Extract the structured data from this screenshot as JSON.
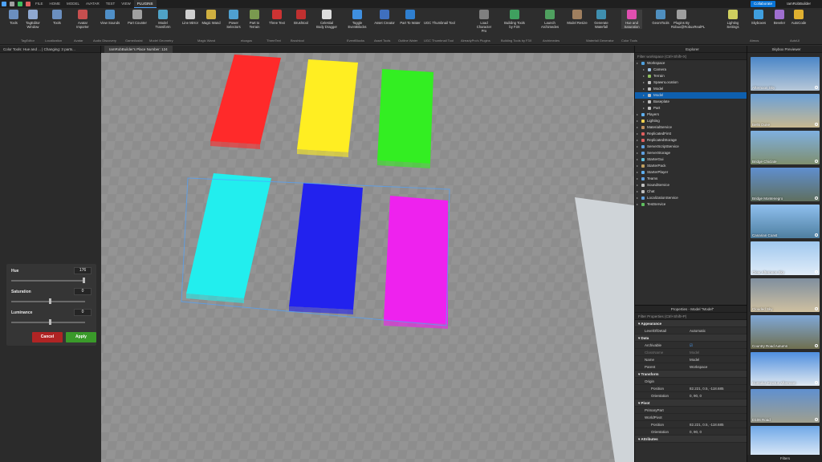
{
  "menubar": {
    "items": [
      "FILE",
      "HOME",
      "MODEL",
      "AVATAR",
      "TEST",
      "VIEW",
      "PLUGINS"
    ],
    "active": "PLUGINS",
    "collaborate": "Collaborate",
    "user": "IamRobBuilder"
  },
  "ribbon": {
    "buttons": [
      {
        "label": "Tools",
        "color": "#6b8fbf"
      },
      {
        "label": "TagEditor Window",
        "color": "#8fa8d0"
      },
      {
        "label": "Tools",
        "color": "#6b8fbf"
      },
      {
        "label": "Avatar Importer",
        "color": "#c74f4f"
      },
      {
        "label": "View Sounds",
        "color": "#4f8fc7"
      },
      {
        "label": "Part Counter",
        "color": "#a0a0a0"
      },
      {
        "label": "Model Transform",
        "color": "#4fa3c7"
      },
      {
        "label": "Line Mirror",
        "color": "#cfcfcf"
      },
      {
        "label": "Magic Wand",
        "color": "#d0b040"
      },
      {
        "label": "Power Selectors",
        "color": "#4fa0d0"
      },
      {
        "label": "Part to Terrain",
        "color": "#7a9a4f"
      },
      {
        "label": "Three Text",
        "color": "#cc3333"
      },
      {
        "label": "Brushtool",
        "color": "#c03030"
      },
      {
        "label": "Celestial Body Dragger",
        "color": "#dddddd"
      },
      {
        "label": "Toggle EventBlocks",
        "color": "#3f8fdf"
      },
      {
        "label": "Asset Creator",
        "color": "#3f6fbf"
      },
      {
        "label": "Part To Water",
        "color": "#2f7fcf"
      },
      {
        "label": "Load Character Pro",
        "color": "#7f7f7f"
      },
      {
        "label": "Building Tools by F3X",
        "color": "#3fa05f"
      },
      {
        "label": "Launch Archimedes",
        "color": "#4fa05f"
      },
      {
        "label": "Model Resize",
        "color": "#9f7f5f"
      },
      {
        "label": "Generate Waterfall",
        "color": "#3f8faf"
      },
      {
        "label": "Hue and Saturation",
        "color": "#e04fb0"
      },
      {
        "label": "GeomTools",
        "color": "#4f8fbf"
      },
      {
        "label": "Plugins By Robux@RobuxRealPL",
        "color": "#9f9f9f"
      },
      {
        "label": "Lighting Settings",
        "color": "#cfcf5f"
      },
      {
        "label": "Skyboxes",
        "color": "#3f9fdf"
      },
      {
        "label": "Beveler",
        "color": "#9f6fcf"
      },
      {
        "label": "AutoCode",
        "color": "#e0b030"
      }
    ],
    "groups": [
      "TagEditor",
      "Localization",
      "Avatar",
      "Audio Discovery",
      "GameAssist",
      "Model Geometry",
      "Magic Wand",
      "eloagus",
      "ThreeText",
      "Brushtool",
      "EventBlocks",
      "Asset Tools",
      "Outline Water",
      "UGC Thumbnail Tool",
      "AlreadyPro's Plugins",
      "Building Tools by F3X",
      "Archimedes",
      "Waterfall Generator",
      "Color Tools",
      "Atmos",
      "AutoUI"
    ],
    "extra": "UGC Thumbnail Tool"
  },
  "colorTools": {
    "title": "Color Tools: Hue and ... | Changing: 3 parts...",
    "hue": {
      "label": "Hue",
      "value": "176",
      "fraction": 0.98
    },
    "saturation": {
      "label": "Saturation",
      "value": "0",
      "fraction": 0.52
    },
    "luminance": {
      "label": "Luminance",
      "value": "0",
      "fraction": 0.52
    },
    "cancel": "Cancel",
    "apply": "Apply",
    "colors": {
      "cancel": "#b02424",
      "apply": "#3a9a2a"
    }
  },
  "viewport": {
    "tab": "IamRobBuilder's Place Number: 124",
    "parts": [
      "#ff2a2a",
      "#ffee22",
      "#33ee22",
      "#22eeee",
      "#2222ee",
      "#ee22ee"
    ]
  },
  "explorer": {
    "title": "Explorer",
    "filter": "Filter workspace (Ctrl+Shift+X)",
    "items": [
      {
        "label": "Workspace",
        "depth": 0,
        "color": "#4fa0df"
      },
      {
        "label": "Camera",
        "depth": 1,
        "color": "#9fbfdf"
      },
      {
        "label": "Terrain",
        "depth": 1,
        "color": "#8fbf5f"
      },
      {
        "label": "SpawnLocation",
        "depth": 1,
        "color": "#bfbfbf"
      },
      {
        "label": "Model",
        "depth": 1,
        "color": "#bfbfbf"
      },
      {
        "label": "Model",
        "depth": 1,
        "color": "#bfbfbf",
        "selected": true
      },
      {
        "label": "Baseplate",
        "depth": 1,
        "color": "#bfbfbf"
      },
      {
        "label": "Part",
        "depth": 1,
        "color": "#bfbfbf"
      },
      {
        "label": "Players",
        "depth": 0,
        "color": "#5fafef"
      },
      {
        "label": "Lighting",
        "depth": 0,
        "color": "#efcf4f"
      },
      {
        "label": "MaterialService",
        "depth": 0,
        "color": "#bf8f5f"
      },
      {
        "label": "ReplicatedFirst",
        "depth": 0,
        "color": "#df5f5f"
      },
      {
        "label": "ReplicatedStorage",
        "depth": 0,
        "color": "#df5f5f"
      },
      {
        "label": "ServerScriptService",
        "depth": 0,
        "color": "#5f9fdf"
      },
      {
        "label": "ServerStorage",
        "depth": 0,
        "color": "#5f9fdf"
      },
      {
        "label": "StarterGui",
        "depth": 0,
        "color": "#5fbfdf"
      },
      {
        "label": "StarterPack",
        "depth": 0,
        "color": "#bf9f5f"
      },
      {
        "label": "StarterPlayer",
        "depth": 0,
        "color": "#5fafef"
      },
      {
        "label": "Teams",
        "depth": 0,
        "color": "#5f9fdf"
      },
      {
        "label": "SoundService",
        "depth": 0,
        "color": "#bfbfbf"
      },
      {
        "label": "Chat",
        "depth": 0,
        "color": "#bfbfbf"
      },
      {
        "label": "LocalizationService",
        "depth": 0,
        "color": "#5f9fdf"
      },
      {
        "label": "TestService",
        "depth": 0,
        "color": "#5fbf5f"
      }
    ]
  },
  "properties": {
    "title": "Properties - Model \"Model\"",
    "filter": "Filter Properties (Ctrl+Shift+P)",
    "rows": [
      {
        "cat": "Appearance"
      },
      {
        "k": "LevelOfDetail",
        "v": "Automatic"
      },
      {
        "cat": "Data"
      },
      {
        "k": "Archivable",
        "v": "☑"
      },
      {
        "k": "ClassName",
        "v": "Model",
        "dim": true
      },
      {
        "k": "Name",
        "v": "Model"
      },
      {
        "k": "Parent",
        "v": "Workspace"
      },
      {
        "cat": "Transform"
      },
      {
        "k": "Origin",
        "v": ""
      },
      {
        "k": "Position",
        "v": "82.221, 0.5, -118.685",
        "indent": true
      },
      {
        "k": "Orientation",
        "v": "0, 90, 0",
        "indent": true
      },
      {
        "cat": "Pivot"
      },
      {
        "k": "PrimaryPart",
        "v": ""
      },
      {
        "k": "WorldPivot",
        "v": ""
      },
      {
        "k": "Position",
        "v": "82.221, 0.5, -118.685",
        "indent": true
      },
      {
        "k": "Orientation",
        "v": "0, 90, 0",
        "indent": true
      },
      {
        "cat": "Attributes"
      }
    ]
  },
  "skybox": {
    "title": "Skybox Previewer",
    "items": [
      {
        "name": "Afternoon Sky",
        "top": "#4a86c8",
        "bottom": "#b8c8d8"
      },
      {
        "name": "Belts Dune",
        "top": "#6aa0d8",
        "bottom": "#c8b890"
      },
      {
        "name": "Bridge Chiclate",
        "top": "#7fb0e0",
        "bottom": "#7f8f6f"
      },
      {
        "name": "Bridge Montenegro",
        "top": "#5f8fcf",
        "bottom": "#5f6f5f"
      },
      {
        "name": "Canarian Coast",
        "top": "#8fc0ef",
        "bottom": "#4f7fa0"
      },
      {
        "name": "Clear Afternoon Sky",
        "top": "#a0c8ef",
        "bottom": "#e0ecf8"
      },
      {
        "name": "Clouded Sky",
        "top": "#7f8f9f",
        "bottom": "#cfc0a0"
      },
      {
        "name": "Country Road Autumn",
        "top": "#7fa8d8",
        "bottom": "#6f6f4f"
      },
      {
        "name": "Cumulus Fractus Afternoon",
        "top": "#4f8fdf",
        "bottom": "#dfe8f0"
      },
      {
        "name": "D106 Road",
        "top": "#5f90d0",
        "bottom": "#9f9f8f"
      },
      {
        "name": "",
        "top": "#6fa8e8",
        "bottom": "#e8f0f8"
      }
    ],
    "filters": "Filters"
  }
}
